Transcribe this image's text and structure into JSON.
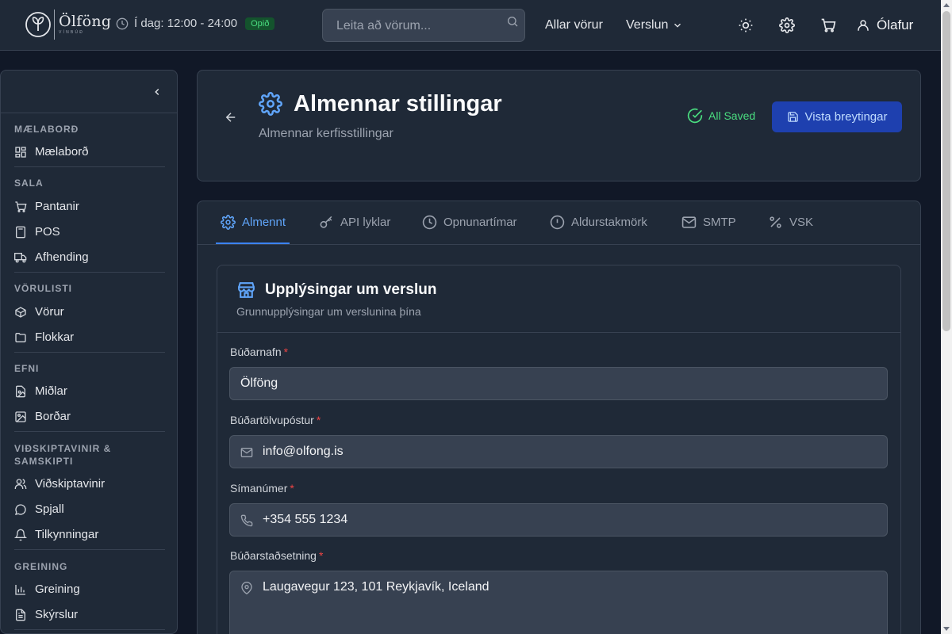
{
  "header": {
    "logo_name": "Ölföng",
    "logo_subtitle": "VÍNBÚÐ",
    "hours": "Í dag: 12:00 - 24:00",
    "open_badge": "Opið",
    "search_placeholder": "Leita að vörum...",
    "nav": {
      "all_products": "Allar vörur",
      "store": "Verslun"
    },
    "user": "Ólafur"
  },
  "sidebar": {
    "sections": [
      {
        "title": "MÆLABORÐ",
        "items": [
          {
            "label": "Mælaborð",
            "icon": "dashboard-icon"
          }
        ]
      },
      {
        "title": "SALA",
        "items": [
          {
            "label": "Pantanir",
            "icon": "cart-icon"
          },
          {
            "label": "POS",
            "icon": "calculator-icon"
          },
          {
            "label": "Afhending",
            "icon": "truck-icon"
          }
        ]
      },
      {
        "title": "VÖRULISTI",
        "items": [
          {
            "label": "Vörur",
            "icon": "box-icon"
          },
          {
            "label": "Flokkar",
            "icon": "folder-icon"
          }
        ]
      },
      {
        "title": "EFNI",
        "items": [
          {
            "label": "Miðlar",
            "icon": "media-icon"
          },
          {
            "label": "Borðar",
            "icon": "image-icon"
          }
        ]
      },
      {
        "title": "VIÐSKIPTAVINIR & SAMSKIPTI",
        "items": [
          {
            "label": "Viðskiptavinir",
            "icon": "users-icon"
          },
          {
            "label": "Spjall",
            "icon": "chat-icon"
          },
          {
            "label": "Tilkynningar",
            "icon": "bell-icon"
          }
        ]
      },
      {
        "title": "GREINING",
        "items": [
          {
            "label": "Greining",
            "icon": "bar-chart-icon"
          },
          {
            "label": "Skýrslur",
            "icon": "report-icon"
          }
        ]
      }
    ]
  },
  "page": {
    "title": "Almennar stillingar",
    "subtitle": "Almennar kerfisstillingar",
    "saved_status": "All Saved",
    "save_button": "Vista breytingar"
  },
  "tabs": [
    {
      "label": "Almennt",
      "icon": "gear-icon",
      "active": true
    },
    {
      "label": "API lyklar",
      "icon": "key-icon",
      "active": false
    },
    {
      "label": "Opnunartímar",
      "icon": "clock-icon",
      "active": false
    },
    {
      "label": "Aldurstakmörk",
      "icon": "alert-circle-icon",
      "active": false
    },
    {
      "label": "SMTP",
      "icon": "mail-icon",
      "active": false
    },
    {
      "label": "VSK",
      "icon": "percent-icon",
      "active": false
    }
  ],
  "store_card": {
    "title": "Upplýsingar um verslun",
    "subtitle": "Grunnupplýsingar um verslunina þína",
    "fields": [
      {
        "label": "Búðarnafn",
        "required": "*",
        "value": "Ölföng"
      },
      {
        "label": "Búðartölvupóstur",
        "required": "*",
        "value": "info@olfong.is",
        "icon": "mail-icon"
      },
      {
        "label": "Símanúmer",
        "required": "*",
        "value": "+354 555 1234",
        "icon": "phone-icon"
      },
      {
        "label": "Búðarstaðsetning",
        "required": "*",
        "value": "Laugavegur 123, 101 Reykjavík, Iceland",
        "icon": "map-pin-icon"
      }
    ]
  },
  "colors": {
    "accent": "#3b82f6",
    "success": "#4ade80",
    "required": "#ef4444",
    "background": "#111827",
    "surface": "#1f2937"
  }
}
